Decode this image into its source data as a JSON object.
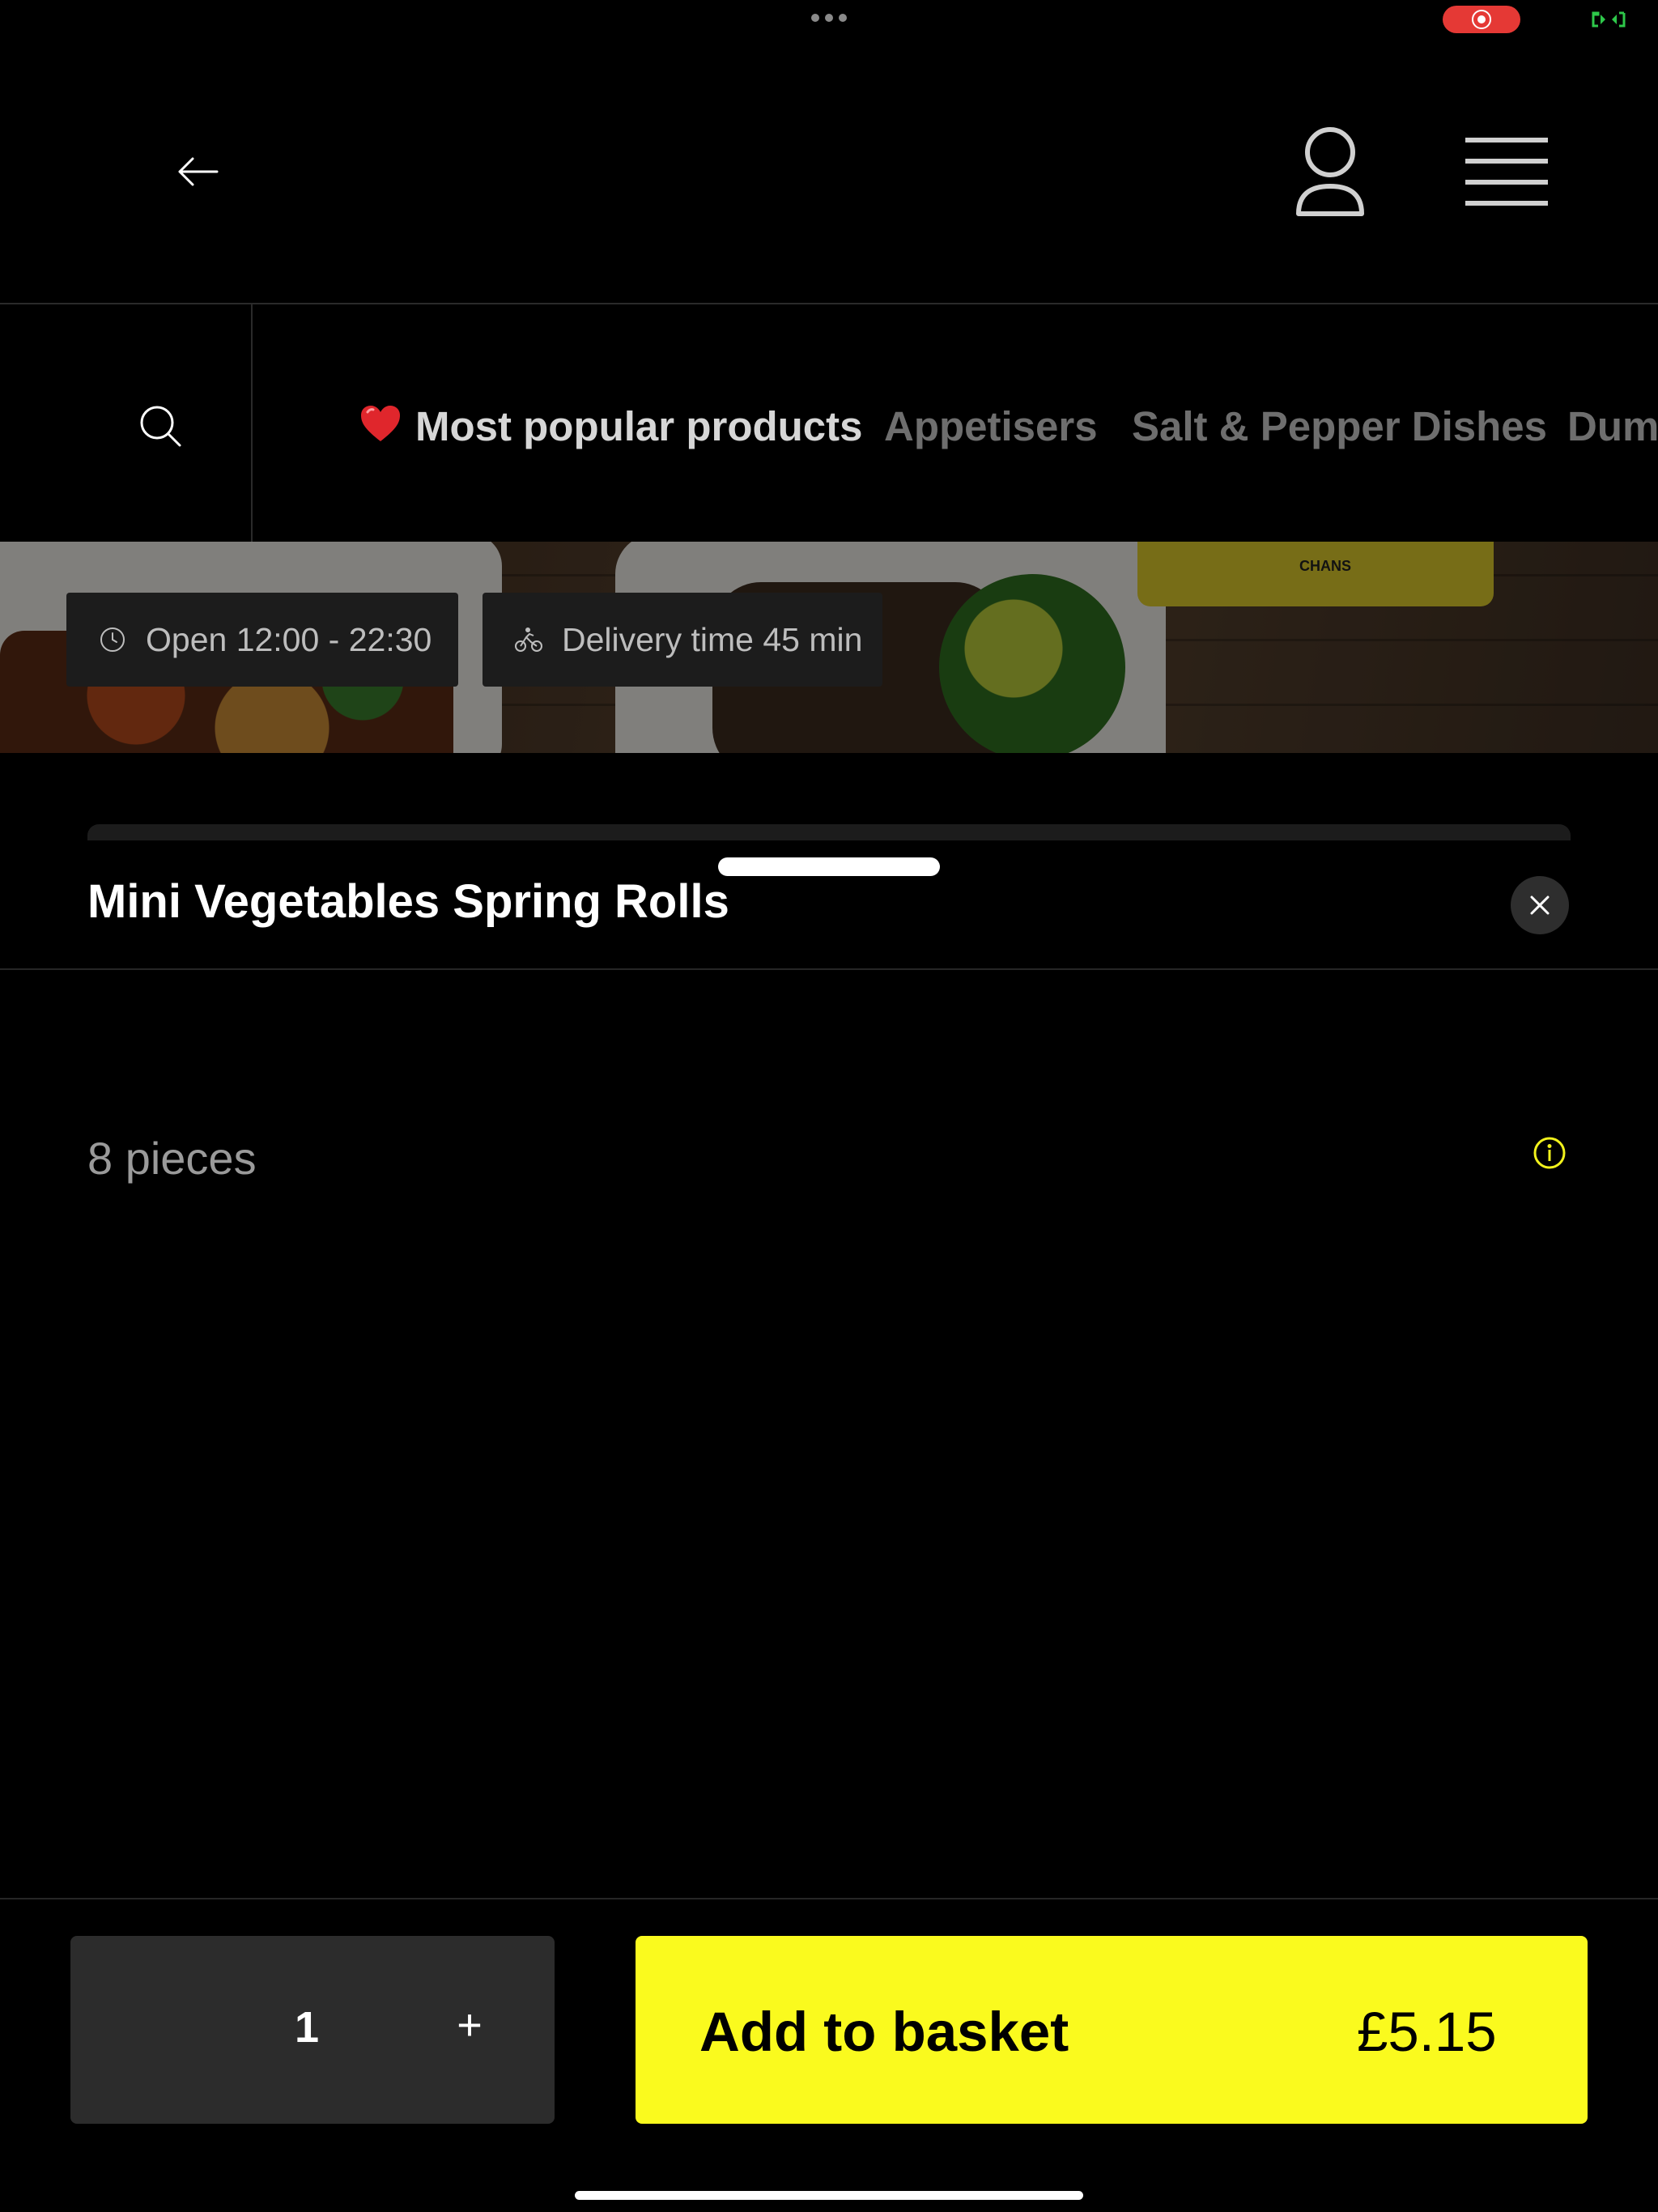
{
  "header": {
    "back_icon": "arrow-left-icon",
    "profile_icon": "user-icon",
    "menu_icon": "hamburger-menu-icon"
  },
  "categories": {
    "search_icon": "search-icon",
    "items": [
      {
        "label": "Most popular products",
        "icon": "heart-emoji",
        "active": true
      },
      {
        "label": "Appetisers",
        "active": false
      },
      {
        "label": "Salt & Pepper Dishes",
        "active": false
      },
      {
        "label": "Dum",
        "active": false
      }
    ]
  },
  "hero": {
    "brand_logo_text": "CHANS",
    "badges": {
      "hours": "Open 12:00 - 22:30",
      "delivery": "Delivery time 45 min"
    }
  },
  "product": {
    "title": "Mini Vegetables Spring Rolls",
    "description": "8 pieces"
  },
  "footer": {
    "quantity": "1",
    "plus_label": "+",
    "add_label": "Add to basket",
    "price": "£5.15"
  },
  "colors": {
    "accent": "#fafa1e",
    "background": "#000000",
    "record_indicator": "#e53935"
  }
}
